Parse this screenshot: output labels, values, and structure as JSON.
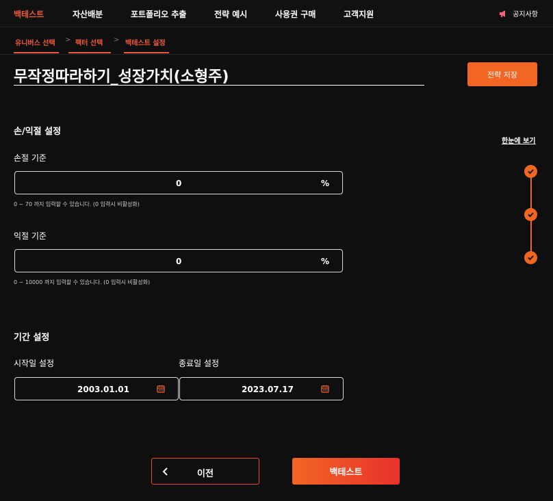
{
  "nav": {
    "items": [
      {
        "label": "백테스트",
        "active": true
      },
      {
        "label": "자산배분"
      },
      {
        "label": "포트폴리오 추출"
      },
      {
        "label": "전략 예시"
      },
      {
        "label": "사용권 구매"
      },
      {
        "label": "고객지원"
      }
    ],
    "notice_label": "공지사항",
    "notice_icon": "megaphone-icon"
  },
  "steps": [
    {
      "label": "유니버스 선택"
    },
    {
      "label": "팩터 선택"
    },
    {
      "label": "백테스트 설정"
    }
  ],
  "strategy": {
    "title": "무작정따라하기_성장가치(소형주)",
    "save_label": "전략 저장"
  },
  "stoploss_section": {
    "title": "손/익절 설정",
    "stop_loss": {
      "label": "손절 기준",
      "value": "0",
      "unit": "%",
      "hint": "0 ~ 70 까지 입력할 수 있습니다. (0 입력시 비활성화)"
    },
    "take_profit": {
      "label": "익절 기준",
      "value": "0",
      "unit": "%",
      "hint": "0 ~ 10000 까지 입력할 수 있습니다. (0 입력시 비활성화)"
    }
  },
  "period_section": {
    "title": "기간 설정",
    "start": {
      "label": "시작일 설정",
      "value": "2003.01.01"
    },
    "end": {
      "label": "종료일 설정",
      "value": "2023.07.17"
    }
  },
  "sidebar": {
    "glance_label": "한눈에 보기",
    "checks": 3
  },
  "footer": {
    "prev_label": "이전",
    "backtest_label": "백테스트"
  },
  "colors": {
    "accent": "#f26624",
    "accent_red": "#e8312b",
    "background": "#0f0f0f"
  }
}
